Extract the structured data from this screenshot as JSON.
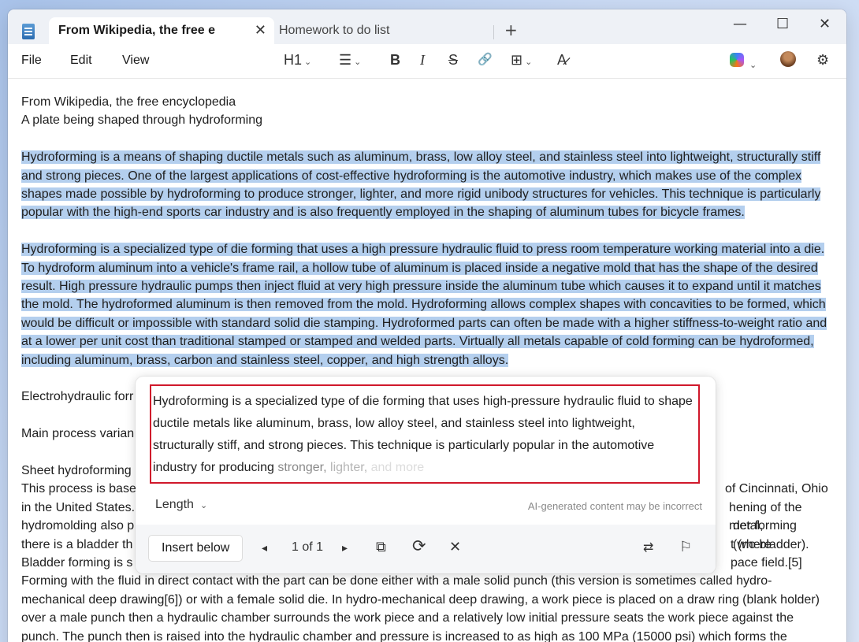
{
  "tabs": {
    "active_title": "From Wikipedia, the free e",
    "inactive_title": "Homework to do list",
    "close_glyph": "✕",
    "new_tab_glyph": "+"
  },
  "window_controls": {
    "minimize": "—",
    "maximize": "☐",
    "close": "✕"
  },
  "menu": {
    "file": "File",
    "edit": "Edit",
    "view": "View"
  },
  "toolbar": {
    "heading": "H1",
    "bold": "B",
    "italic": "I",
    "strike": "S",
    "list_glyph": "☰",
    "link_glyph": "🔗",
    "table_glyph": "⊞",
    "spellcheck_glyph": "A̷",
    "settings_glyph": "⚙"
  },
  "document": {
    "line1": "From Wikipedia, the free encyclopedia",
    "line2": "A plate being shaped through hydroforming",
    "para1": "Hydroforming is a means of shaping ductile metals such as aluminum, brass, low alloy steel, and stainless steel into lightweight, structurally stiff and strong pieces. One of the largest applications of cost-effective hydroforming is the automotive industry, which makes use of the complex shapes made possible by hydroforming to produce stronger, lighter, and more rigid unibody structures for vehicles. This technique is particularly popular with the high-end sports car industry and is also frequently employed in the shaping of aluminum tubes for bicycle frames.",
    "para2": "Hydroforming is a specialized type of die forming that uses a high pressure hydraulic fluid to press room temperature working material into a die. To hydroform aluminum into a vehicle's frame rail, a hollow tube of aluminum is placed inside a negative mold that has the shape of the desired result. High pressure hydraulic pumps then inject fluid at very high pressure inside the aluminum tube which causes it to expand until it matches the mold. The hydroformed aluminum is then removed from the mold. Hydroforming allows complex shapes with concavities to be formed, which would be difficult or impossible with standard solid die stamping. Hydroformed parts can often be made with a higher stiffness-to-weight ratio and at a lower per unit cost than traditional stamped or stamped and welded parts. Virtually all metals capable of cold forming can be hydroformed, including aluminum, brass, carbon and stainless steel, copper, and high strength alloys.",
    "line_electro": "Electrohydraulic forr",
    "line_main": "Main process varian",
    "line_sheet": "Sheet hydroforming",
    "line_process_left": "This process is basec",
    "line_process_right": "of Cincinnati, Ohio",
    "line_us_left": "in the United States.",
    "line_us_right": "hening of the metal,",
    "line_hydromold_left": "hydromolding also p",
    "line_hydromold_right": "der forming (where",
    "line_bladder_left": "there is a bladder th",
    "line_bladder_right": "t (no bladder).",
    "line_bladderform_left": "Bladder forming is s",
    "line_bladderform_right": "pace field.[5]",
    "para_tail": "Forming with the fluid in direct contact with the part can be done either with a male solid punch (this version is sometimes called hydro-mechanical deep drawing[6]) or with a female solid die. In hydro-mechanical deep drawing, a work piece is placed on a draw ring (blank holder) over a male punch then a hydraulic chamber surrounds the work piece and a relatively low initial pressure seats the work piece against the punch. The punch then is raised into the hydraulic chamber and pressure is increased to as high as 100 MPa (15000 psi) which forms the"
  },
  "rewrite_popup": {
    "suggestion_main": "Hydroforming is a specialized type of die forming that uses high-pressure hydraulic fluid to shape ductile metals like aluminum, brass, low alloy steel, and stainless steel into lightweight, structurally stiff, and strong pieces. This technique is particularly popular in the automotive industry for producing ",
    "suggestion_fade1": "stronger, ",
    "suggestion_fade2": "lighter, ",
    "suggestion_fade3": "and more",
    "length_label": "Length",
    "disclaimer": "AI-generated content may be incorrect",
    "insert_label": "Insert below",
    "pager": "1 of 1",
    "prev_glyph": "◂",
    "next_glyph": "▸",
    "copy_glyph": "⧉",
    "regenerate_glyph": "⟳",
    "dismiss_glyph": "✕",
    "adjust_glyph": "⇄",
    "flag_glyph": "⚐"
  }
}
